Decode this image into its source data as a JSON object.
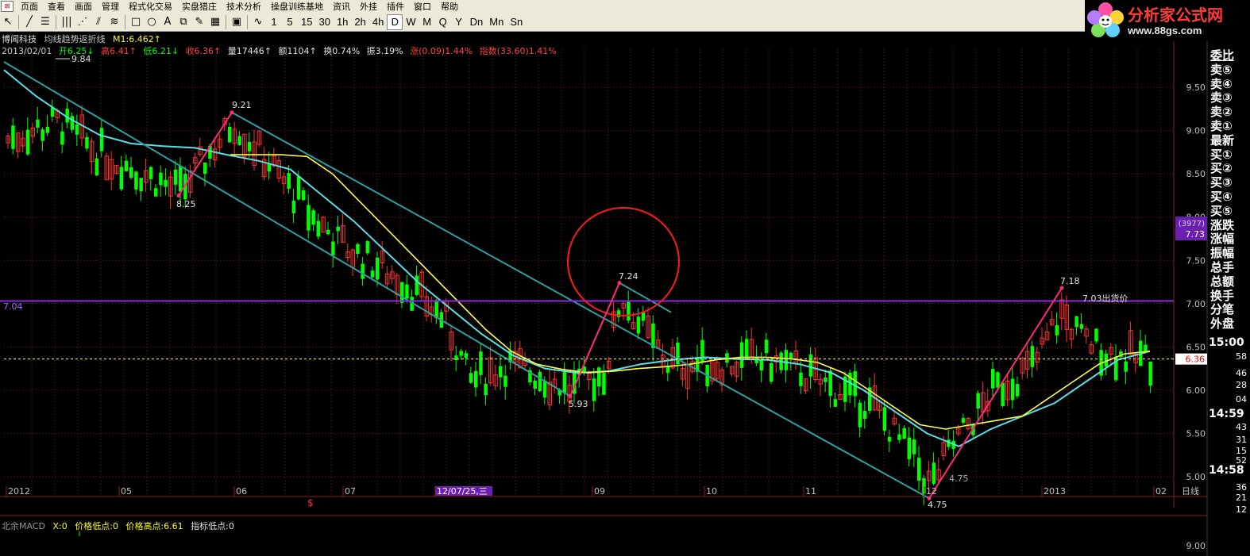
{
  "menu": {
    "items": [
      "页面",
      "查看",
      "画面",
      "管理",
      "程式化交易",
      "实盘猎庄",
      "技术分析",
      "操盘训练基地",
      "资讯",
      "外挂",
      "插件",
      "窗口",
      "帮助"
    ]
  },
  "toolbar": {
    "tools": [
      "cursor-tool-icon",
      "line-tool-icon",
      "hline-tool-icon",
      "bars-tool-icon",
      "fan-tool-icon",
      "channel-tool-icon",
      "fib-tool-icon",
      "rect-tool-icon",
      "ellipse-tool-icon",
      "text-tool-icon",
      "copy-tool-icon",
      "pen-tool-icon",
      "palette-tool-icon",
      "save-tool-icon",
      "wave-tool-icon"
    ],
    "periods": [
      "1",
      "5",
      "15",
      "30",
      "1h",
      "2h",
      "4h",
      "D",
      "W",
      "M",
      "Q",
      "Y",
      "Dn",
      "Mn",
      "Sn"
    ],
    "active_period": "D"
  },
  "logo": {
    "title": "分析家公式网",
    "url": "www.88gs.com"
  },
  "header": {
    "stock_name": "博闻科技",
    "formula_name": "均线趋势返折线",
    "m1_label": "M1:6.462↑",
    "date": "2013/02/01",
    "open": "开6.25↓",
    "high": "高6.41↑",
    "low": "低6.21↓",
    "close": "收6.36↑",
    "volume": "量17446↑",
    "amount": "额1104↑",
    "turnover": "换0.74%",
    "amplitude": "振3.19%",
    "change": "涨(0.09)1.44%",
    "index": "指数(33.60)1.41%"
  },
  "right_panel": {
    "items": [
      "委比",
      "卖⑤",
      "卖④",
      "卖③",
      "卖②",
      "卖①",
      "最新",
      "买①",
      "买②",
      "买③",
      "买④",
      "买⑤",
      "涨跌",
      "涨幅",
      "振幅",
      "总手",
      "总额",
      "换手",
      "分笔",
      "外盘"
    ],
    "times": [
      "15:00",
      "14:59",
      "14:58"
    ],
    "seconds": [
      "58",
      "46",
      "28",
      "04",
      "43",
      "31",
      "15",
      "52",
      "36",
      "21",
      "12"
    ]
  },
  "price_axis": {
    "labels": [
      "9.50",
      "9.00",
      "8.50",
      "8.00",
      "7.50",
      "7.00",
      "6.50",
      "6.00",
      "5.50",
      "5.00"
    ],
    "current_price": "6.36",
    "tag_count": "(3977)",
    "tag_price": "7.73",
    "bottom_label": "9.00"
  },
  "time_axis": {
    "labels": [
      "2012",
      "05",
      "06",
      "07",
      "12/07/25,三",
      "09",
      "10",
      "11",
      "12",
      "2013",
      "02"
    ],
    "period_label": "日线",
    "marker": "$"
  },
  "annotations": {
    "left_line_value": "7.04",
    "sell_label": "7.03出货价",
    "peak_high": "9.84",
    "points": [
      "9.21",
      "8.25",
      "5.93",
      "7.24",
      "7.18",
      "4.75",
      "4.75"
    ]
  },
  "indicator": {
    "name": "北余MACD",
    "x": "X:0",
    "price_low": "价格低点:0",
    "price_high": "价格高点:6.61",
    "index_low": "指标低点:0"
  },
  "colors": {
    "up": "#ff3030",
    "down": "#00ff00",
    "ma_cyan": "#57e0e8",
    "ma_yellow": "#ffff40",
    "trend_line": "#2aa0a0",
    "zigzag": "#ff2a7a",
    "purple": "#8a2be2",
    "grid": "#8a1a1a"
  },
  "chart_data": {
    "type": "candlestick",
    "y_range": [
      4.7,
      9.9
    ],
    "horizontal_line": 7.03,
    "zigzag_points": [
      {
        "label": "8.25",
        "value": 8.25
      },
      {
        "label": "9.21",
        "value": 9.21
      },
      {
        "label": "5.93",
        "value": 5.93
      },
      {
        "label": "7.24",
        "value": 7.24
      },
      {
        "label": "4.75",
        "value": 4.75
      },
      {
        "label": "7.18",
        "value": 7.18
      }
    ],
    "ma_series": [
      {
        "values": [
          9.7,
          9.4,
          9.15,
          8.95,
          8.85,
          8.82,
          8.8,
          8.72,
          8.65,
          8.55,
          8.25,
          7.95,
          7.6,
          7.25,
          6.95,
          6.65,
          6.4,
          6.25,
          6.2,
          6.22,
          6.3,
          6.35,
          6.38,
          6.36,
          6.35,
          6.3,
          6.2,
          6.0,
          5.75,
          5.5,
          5.35,
          5.55,
          5.7,
          5.85,
          6.1,
          6.35,
          6.45
        ]
      },
      {
        "values": [
          8.72,
          8.72,
          8.72,
          8.7,
          8.5,
          8.2,
          7.9,
          7.6,
          7.3,
          7.0,
          6.7,
          6.45,
          6.3,
          6.24,
          6.2,
          6.22,
          6.25,
          6.27,
          6.3,
          6.35,
          6.38,
          6.38,
          6.36,
          6.32,
          6.2,
          6.0,
          5.8,
          5.6,
          5.55,
          5.6,
          5.65,
          5.7,
          5.9,
          6.1,
          6.3,
          6.42,
          6.45
        ]
      }
    ]
  }
}
